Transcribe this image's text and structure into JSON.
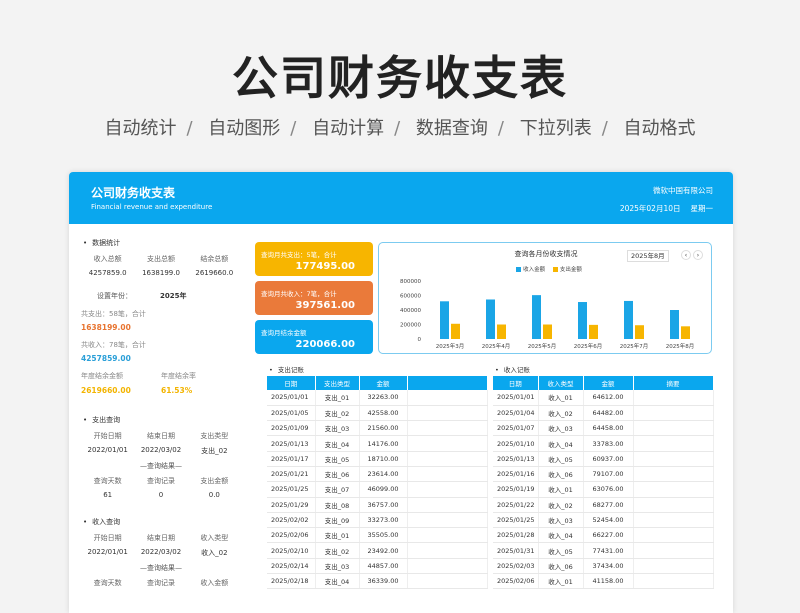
{
  "hero": {
    "title": "公司财务收支表",
    "features": [
      "自动统计",
      "自动图形",
      "自动计算",
      "数据查询",
      "下拉列表",
      "自动格式"
    ]
  },
  "header": {
    "title": "公司财务收支表",
    "subtitle": "Financial revenue and expenditure",
    "company": "微软中国有限公司",
    "date": "2025年02月10日",
    "weekday": "星期一"
  },
  "stats": {
    "section": "数据统计",
    "headers": [
      "收入总额",
      "支出总额",
      "结余总额"
    ],
    "values": [
      "4257859.0",
      "1638199.0",
      "2619660.0"
    ],
    "year_label": "设置年份：",
    "year": "2025年",
    "expense_line": "共支出：58笔，合计",
    "expense_total": "1638199.00",
    "income_line": "共收入：78笔，合计",
    "income_total": "4257859.00",
    "balance_label": "年度结余金额",
    "balance_value": "2619660.00",
    "rate_label": "年度结余率",
    "rate_value": "61.53%"
  },
  "expense_query": {
    "section": "支出查询",
    "headers": [
      "开始日期",
      "结束日期",
      "支出类型"
    ],
    "values": [
      "2022/01/01",
      "2022/03/02",
      "支出_02"
    ],
    "result_label": "—查询结果—",
    "result_headers": [
      "查询天数",
      "查询记录",
      "支出金额"
    ],
    "result_values": [
      "61",
      "0",
      "0.0"
    ]
  },
  "income_query": {
    "section": "收入查询",
    "headers": [
      "开始日期",
      "结束日期",
      "收入类型"
    ],
    "values": [
      "2022/01/01",
      "2022/03/02",
      "收入_02"
    ],
    "result_label": "—查询结果—",
    "result_headers": [
      "查询天数",
      "查询记录",
      "收入金额"
    ]
  },
  "kpis": [
    {
      "label": "查询月共支出：5笔，合计",
      "value": "177495.00",
      "color": "#f7b500"
    },
    {
      "label": "查询月共收入：7笔，合计",
      "value": "397561.00",
      "color": "#ea7a3a"
    },
    {
      "label": "查询月结余金额",
      "value": "220066.00",
      "color": "#0aa7ee"
    }
  ],
  "chart": {
    "title": "查询各月份收支情况",
    "selected_month": "2025年8月",
    "prev": "‹",
    "next": "›"
  },
  "chart_data": {
    "type": "bar",
    "categories": [
      "2025年3月",
      "2025年4月",
      "2025年5月",
      "2025年6月",
      "2025年7月",
      "2025年8月"
    ],
    "series": [
      {
        "name": "收入金额",
        "values": [
          520000,
          545000,
          605000,
          510000,
          525000,
          400000
        ],
        "color": "#1aa5e6"
      },
      {
        "name": "支出金额",
        "values": [
          210000,
          200000,
          200000,
          195000,
          190000,
          175000
        ],
        "color": "#f7b500"
      }
    ],
    "yticks": [
      "800000",
      "600000",
      "400000",
      "200000",
      "0"
    ],
    "ylim": [
      0,
      800000
    ]
  },
  "expense_table": {
    "title": "支出记账",
    "headers": [
      "日期",
      "支出类型",
      "金额",
      ""
    ],
    "rows": [
      [
        "2025/01/01",
        "支出_01",
        "32263.00"
      ],
      [
        "2025/01/05",
        "支出_02",
        "42558.00"
      ],
      [
        "2025/01/09",
        "支出_03",
        "21560.00"
      ],
      [
        "2025/01/13",
        "支出_04",
        "14176.00"
      ],
      [
        "2025/01/17",
        "支出_05",
        "18710.00"
      ],
      [
        "2025/01/21",
        "支出_06",
        "23614.00"
      ],
      [
        "2025/01/25",
        "支出_07",
        "46099.00"
      ],
      [
        "2025/01/29",
        "支出_08",
        "36757.00"
      ],
      [
        "2025/02/02",
        "支出_09",
        "33273.00"
      ],
      [
        "2025/02/06",
        "支出_01",
        "35505.00"
      ],
      [
        "2025/02/10",
        "支出_02",
        "23492.00"
      ],
      [
        "2025/02/14",
        "支出_03",
        "44857.00"
      ],
      [
        "2025/02/18",
        "支出_04",
        "36339.00"
      ]
    ]
  },
  "income_table": {
    "title": "收入记账",
    "headers": [
      "日期",
      "收入类型",
      "金额",
      "摘要"
    ],
    "rows": [
      [
        "2025/01/01",
        "收入_01",
        "64612.00"
      ],
      [
        "2025/01/04",
        "收入_02",
        "64482.00"
      ],
      [
        "2025/01/07",
        "收入_03",
        "64458.00"
      ],
      [
        "2025/01/10",
        "收入_04",
        "33783.00"
      ],
      [
        "2025/01/13",
        "收入_05",
        "60937.00"
      ],
      [
        "2025/01/16",
        "收入_06",
        "79107.00"
      ],
      [
        "2025/01/19",
        "收入_01",
        "63076.00"
      ],
      [
        "2025/01/22",
        "收入_02",
        "68277.00"
      ],
      [
        "2025/01/25",
        "收入_03",
        "52454.00"
      ],
      [
        "2025/01/28",
        "收入_04",
        "66227.00"
      ],
      [
        "2025/01/31",
        "收入_05",
        "77431.00"
      ],
      [
        "2025/02/03",
        "收入_06",
        "37434.00"
      ],
      [
        "2025/02/06",
        "收入_01",
        "41158.00"
      ]
    ]
  }
}
